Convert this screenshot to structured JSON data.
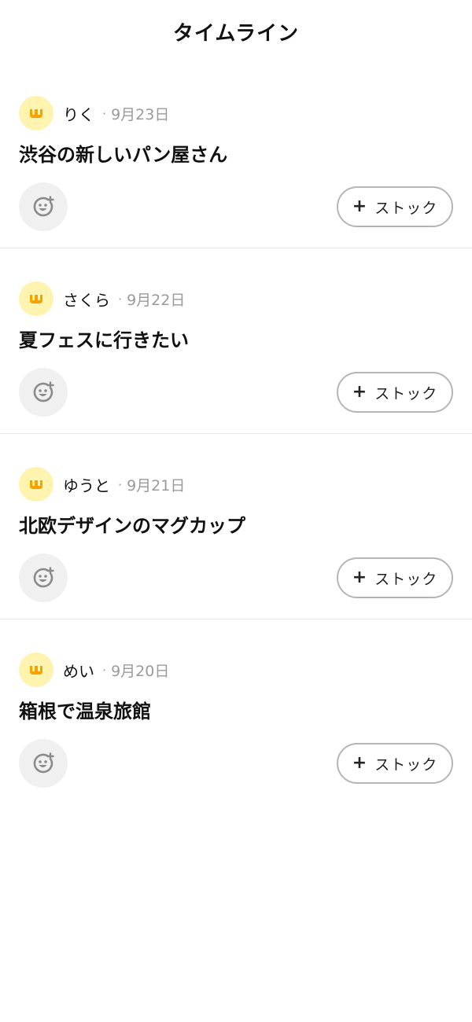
{
  "header": {
    "title": "タイムライン"
  },
  "posts": [
    {
      "user": "りく",
      "separator": "·",
      "date": "9月23日",
      "title": "渋谷の新しいパン屋さん",
      "stock_plus": "+",
      "stock_label": "ストック"
    },
    {
      "user": "さくら",
      "separator": "·",
      "date": "9月22日",
      "title": "夏フェスに行きたい",
      "stock_plus": "+",
      "stock_label": "ストック"
    },
    {
      "user": "ゆうと",
      "separator": "·",
      "date": "9月21日",
      "title": "北欧デザインのマグカップ",
      "stock_plus": "+",
      "stock_label": "ストック"
    },
    {
      "user": "めい",
      "separator": "·",
      "date": "9月20日",
      "title": "箱根で温泉旅館",
      "stock_plus": "+",
      "stock_label": "ストック"
    }
  ],
  "colors": {
    "avatar_bg": "#fff3b0",
    "avatar_logo": "#f5a300",
    "reaction_bg": "#f0f0f0",
    "reaction_icon": "#8a8a8a",
    "date_text": "#9a9a9a",
    "button_border": "#b5b5b5"
  },
  "icons": {
    "avatar": "w-logo-icon",
    "reaction": "add-reaction-smiley-icon"
  }
}
